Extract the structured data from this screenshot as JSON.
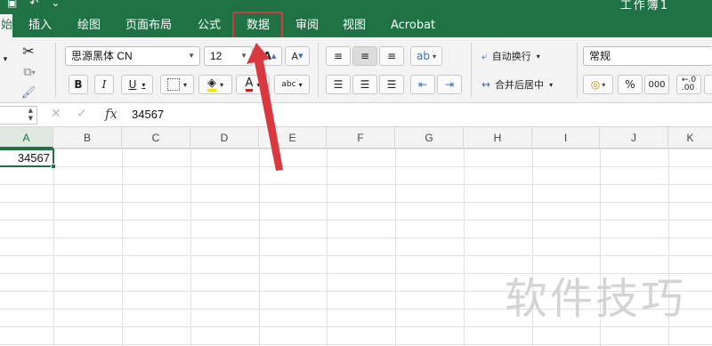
{
  "app": {
    "doc_title": "工作簿1",
    "accent_color": "#1f7244",
    "highlight_color": "#d9383f"
  },
  "tabs": [
    {
      "label": "始",
      "active": true
    },
    {
      "label": "插入"
    },
    {
      "label": "绘图"
    },
    {
      "label": "页面布局"
    },
    {
      "label": "公式"
    },
    {
      "label": "数据",
      "highlighted": true
    },
    {
      "label": "审阅"
    },
    {
      "label": "视图"
    },
    {
      "label": "Acrobat"
    }
  ],
  "ribbon": {
    "font_name": "思源黑体 CN",
    "font_size": "12",
    "bold": "B",
    "italic": "I",
    "underline": "U",
    "font_color_glyph": "A",
    "abc_label": "abc",
    "wrap_text": "自动换行",
    "merge_center": "合并后居中",
    "number_format": "常规",
    "percent": "%",
    "thousands": "000",
    "decimal_add": ".0\n.00"
  },
  "formula_bar": {
    "fx": "fx",
    "value": "34567"
  },
  "columns": [
    "A",
    "B",
    "C",
    "D",
    "E",
    "F",
    "G",
    "H",
    "I",
    "J",
    "K"
  ],
  "cells": {
    "A1": "34567"
  },
  "watermark": "软件技巧"
}
